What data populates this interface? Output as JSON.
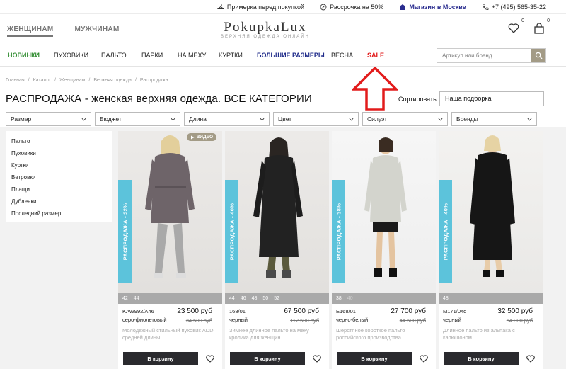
{
  "topbar": {
    "fitting": "Примерка перед покупкой",
    "installment": "Рассрочка на 50%",
    "store": "Магазин в Москве",
    "phone": "+7 (495) 565-35-22"
  },
  "header": {
    "women": "ЖЕНЩИНАМ",
    "men": "МУЖЧИНАМ",
    "logo": "PokupkaLux",
    "tagline": "ВЕРХНЯЯ ОДЕЖДА ОНЛАЙН",
    "fav_count": "0",
    "cart_count": "0"
  },
  "nav": {
    "items": [
      "НОВИНКИ",
      "ПУХОВИКИ",
      "ПАЛЬТО",
      "ПАРКИ",
      "НА МЕХУ",
      "КУРТКИ",
      "БОЛЬШИЕ РАЗМЕРЫ",
      "ВЕСНА",
      "SALE"
    ],
    "search_placeholder": "Артикул или бренд"
  },
  "breadcrumb": [
    "Главная",
    "Каталог",
    "Женщинам",
    "Верхняя одежда",
    "Распродажа"
  ],
  "page_title": "РАСПРОДАЖА - женская верхняя одежда. ВСЕ КАТЕГОРИИ",
  "sort": {
    "label": "Сортировать:",
    "value": "Наша подборка"
  },
  "filters": [
    "Размер",
    "Бюджет",
    "Длина",
    "Цвет",
    "Силуэт",
    "Бренды"
  ],
  "categories": [
    "Пальто",
    "Пуховики",
    "Куртки",
    "Ветровки",
    "Плащи",
    "Дубленки",
    "Последний размер"
  ],
  "products": [
    {
      "sale": "РАСПРОДАЖА - 32%",
      "video": "ВИДЕО",
      "sizes": [
        "42",
        "44"
      ],
      "sku": "KAW992/A46",
      "price": "23 500 руб",
      "color": "серо-фиолетовый",
      "old_price": "34 500 руб",
      "desc": "Молодежный стильный пуховик ADD средней длины",
      "cart": "В корзину"
    },
    {
      "sale": "РАСПРОДАЖА - 40%",
      "sizes": [
        "44",
        "46",
        "48",
        "50",
        "52"
      ],
      "sku": "168/01",
      "price": "67 500 руб",
      "color": "черный",
      "old_price": "112 500 руб",
      "desc": "Зимнее длинное пальто на меху кролика для женщин",
      "cart": "В корзину"
    },
    {
      "sale": "РАСПРОДАЖА - 38%",
      "sizes": [
        "38",
        "40"
      ],
      "sku": "E168/01",
      "price": "27 700 руб",
      "color": "черно-белый",
      "old_price": "44 500 руб",
      "desc": "Шерстяное короткое пальто российского производства",
      "cart": "В корзину"
    },
    {
      "sale": "РАСПРОДАЖА - 40%",
      "sizes": [
        "48"
      ],
      "sku": "M171/04d",
      "price": "32 500 руб",
      "color": "черный",
      "old_price": "54 000 руб",
      "desc": "Длинное пальто из альпака с капюшоном",
      "cart": "В корзину"
    }
  ],
  "colors": {
    "sale_band": "#5cc3db",
    "sale_link": "#e21b1b",
    "new_link": "#2e8b2e",
    "accent": "#a39b86",
    "cart_btn": "#2a2a2e"
  }
}
